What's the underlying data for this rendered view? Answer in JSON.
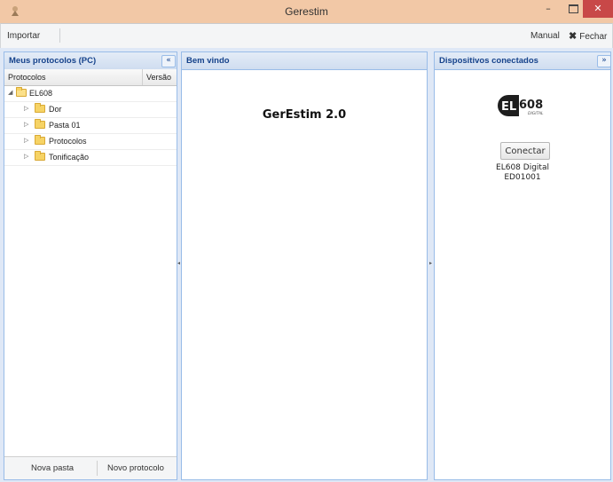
{
  "window": {
    "title": "Gerestim",
    "minimize_glyph": "–",
    "close_glyph": "✕"
  },
  "toolbar": {
    "import_label": "Importar",
    "manual_label": "Manual",
    "close_glyph": "✖",
    "close_label": "Fechar"
  },
  "left_panel": {
    "title": "Meus protocolos (PC)",
    "collapse_glyph": "«",
    "columns": [
      "Protocolos",
      "Versão"
    ],
    "tree": {
      "root": {
        "label": "EL608",
        "expanded": true,
        "icon": "folder-open-icon"
      },
      "children": [
        {
          "label": "Dor",
          "icon": "folder-icon"
        },
        {
          "label": "Pasta 01",
          "icon": "folder-icon"
        },
        {
          "label": "Protocolos",
          "icon": "folder-icon"
        },
        {
          "label": "Tonificação",
          "icon": "folder-icon"
        }
      ]
    },
    "footer": {
      "new_folder_label": "Nova pasta",
      "new_protocol_label": "Novo protocolo"
    }
  },
  "center_panel": {
    "title": "Bem vindo",
    "welcome_text": "GerEstim 2.0"
  },
  "right_panel": {
    "title": "Dispositivos conectados",
    "expand_glyph": "»",
    "logo": {
      "text": "608",
      "sub": "DIGITAL"
    },
    "connect_label": "Conectar",
    "device_name": "EL608 Digital",
    "device_id": "ED01001"
  },
  "colors": {
    "accent_blue": "#15428b",
    "panel_border": "#99bce8",
    "close_red": "#c84848",
    "titlebar": "#f2c8a6"
  }
}
